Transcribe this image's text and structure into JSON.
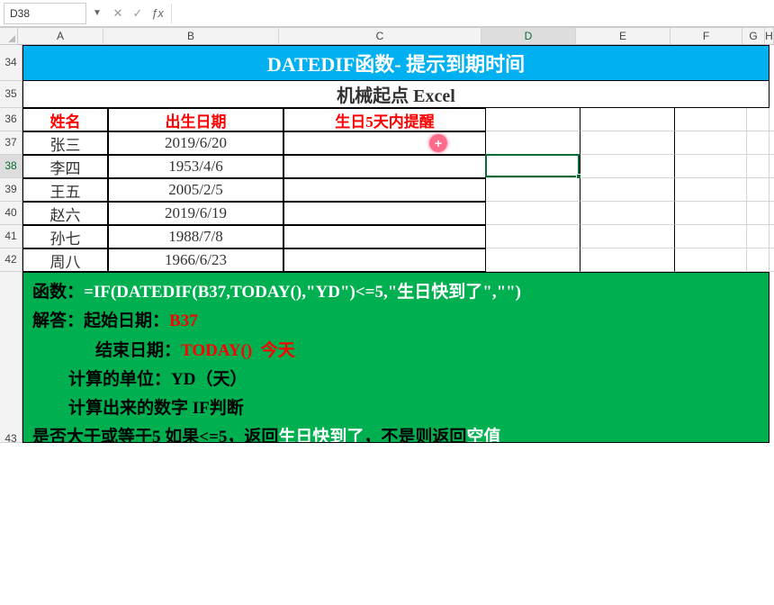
{
  "formula_bar": {
    "active_cell": "D38",
    "formula": ""
  },
  "columns": [
    "A",
    "B",
    "C",
    "D",
    "E",
    "F",
    "G",
    "H"
  ],
  "rows": [
    "34",
    "35",
    "36",
    "37",
    "38",
    "39",
    "40",
    "41",
    "42",
    "43"
  ],
  "title": "DATEDIF函数- 提示到期时间",
  "subtitle": "机械起点 Excel",
  "headers": {
    "name": "姓名",
    "birthdate": "出生日期",
    "reminder": "生日5天内提醒"
  },
  "table": [
    {
      "name": "张三",
      "birthdate": "2019/6/20",
      "reminder": ""
    },
    {
      "name": "李四",
      "birthdate": "1953/4/6",
      "reminder": ""
    },
    {
      "name": "王五",
      "birthdate": "2005/2/5",
      "reminder": ""
    },
    {
      "name": "赵六",
      "birthdate": "2019/6/19",
      "reminder": ""
    },
    {
      "name": "孙七",
      "birthdate": "1988/7/8",
      "reminder": ""
    },
    {
      "name": "周八",
      "birthdate": "1966/6/23",
      "reminder": ""
    }
  ],
  "explain": {
    "l1a": "函数：",
    "l1b": "=IF(DATEDIF(B37,TODAY(),\"YD\")<=5,\"生日快到了\",\"\")",
    "l2a": "解答：",
    "l2b": "起始日期：",
    "l2c": "B37",
    "l3a": "结束日期：",
    "l3b": "TODAY()",
    "l3c": "今天",
    "l4a": "计算的单位：YD（天）",
    "l5a": "计算出来的数字  IF判断",
    "l6a": "是否大于或等于5  如果<=5，返回",
    "l6b": "生日快到了",
    "l6c": "，不是则返回",
    "l6d": "空值"
  },
  "selected": {
    "cell": "D38"
  }
}
